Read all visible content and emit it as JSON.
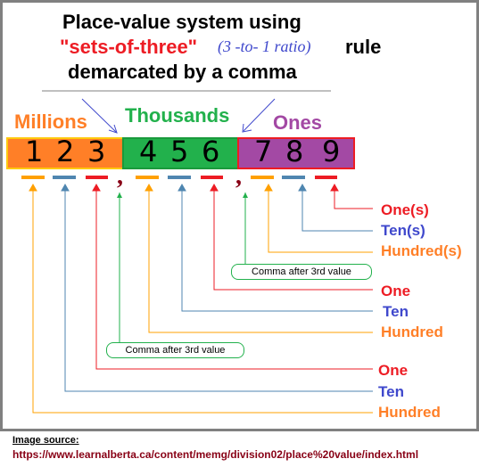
{
  "title": {
    "line1": "Place-value system using",
    "line2_highlight": "\"sets-of-three\"",
    "line2_ratio": "(3 -to- 1 ratio)",
    "line2_end": "rule",
    "line3": "demarcated by a comma"
  },
  "periods": [
    {
      "name": "Millions",
      "digits": [
        "1",
        "2",
        "3"
      ],
      "color": "#ff7f27",
      "border": "#ffc90e",
      "label_color": "#ff7f27"
    },
    {
      "name": "Thousands",
      "digits": [
        "4",
        "5",
        "6"
      ],
      "color": "#22b14c",
      "border": "#1a9a3c",
      "label_color": "#22b14c"
    },
    {
      "name": "Ones",
      "digits": [
        "7",
        "8",
        "9"
      ],
      "color": "#a349a4",
      "border": "#ed1c24",
      "label_color": "#a349a4"
    }
  ],
  "comma_glyph": ",",
  "comma_note": "Comma after 3rd value",
  "place_labels": {
    "ones_period": [
      "One(s)",
      "Ten(s)",
      "Hundred(s)"
    ],
    "thousands_period": [
      "One",
      "Ten",
      "Hundred"
    ],
    "millions_period": [
      "One",
      "Ten",
      "Hundred"
    ]
  },
  "colors": {
    "one": "#ed1c24",
    "ten": "#3f48cc",
    "hundred": "#ff7f27",
    "line_one": "#ed1c24",
    "line_ten": "#4f86b0",
    "line_hundred": "#ffa000",
    "comma": "#880015",
    "comma_note_border": "#22b14c",
    "arrow": "#3f48cc"
  },
  "source": {
    "label": "Image source:",
    "url": "https://www.learnalberta.ca/content/memg/division02/place%20value/index.html"
  }
}
